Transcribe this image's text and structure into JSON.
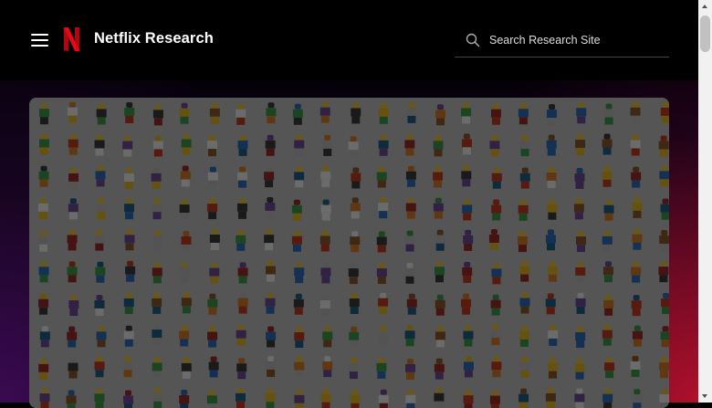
{
  "header": {
    "menu_icon": "hamburger-menu-icon",
    "logo_icon": "netflix-n-logo",
    "title": "Netflix Research",
    "search": {
      "icon": "search-icon",
      "placeholder": "Search Research Site",
      "value": ""
    }
  },
  "hero": {
    "image": "grid of lego minifigures on wall"
  },
  "colors": {
    "brand_red": "#e50914",
    "header_bg": "#000000",
    "gradient_red": "#b0102a",
    "gradient_purple": "#3a0a52"
  }
}
